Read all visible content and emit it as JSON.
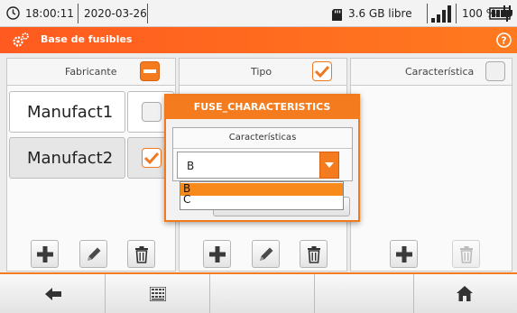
{
  "status_bar": {
    "time": "18:00:11",
    "date": "2020-03-26",
    "storage": "3.6 GB libre",
    "battery_percent": "100 %"
  },
  "title_bar": {
    "title": "Base de fusibles"
  },
  "columns": {
    "manufacturer": {
      "header": "Fabricante",
      "header_checkbox_state": "indeterminate",
      "rows": [
        {
          "label": "Manufact1",
          "checked": false
        },
        {
          "label": "Manufact2",
          "checked": true
        }
      ]
    },
    "type": {
      "header": "Tipo",
      "header_checkbox_state": "checked"
    },
    "characteristic": {
      "header": "Característica",
      "header_checkbox_state": "unchecked"
    }
  },
  "dialog": {
    "title": "FUSE_CHARACTERISTICS",
    "group_label": "Características",
    "selected_value": "B",
    "options": [
      "B",
      "C"
    ],
    "highlighted_option": "B"
  },
  "colors": {
    "accent": "#f47c1e",
    "title_gradient_start": "#ff5a1f"
  },
  "icons": {
    "bottom_bar": [
      "back-arrow-icon",
      "keyboard-icon",
      "home-icon"
    ],
    "toolbar": [
      "add-icon",
      "edit-icon",
      "delete-icon"
    ]
  }
}
